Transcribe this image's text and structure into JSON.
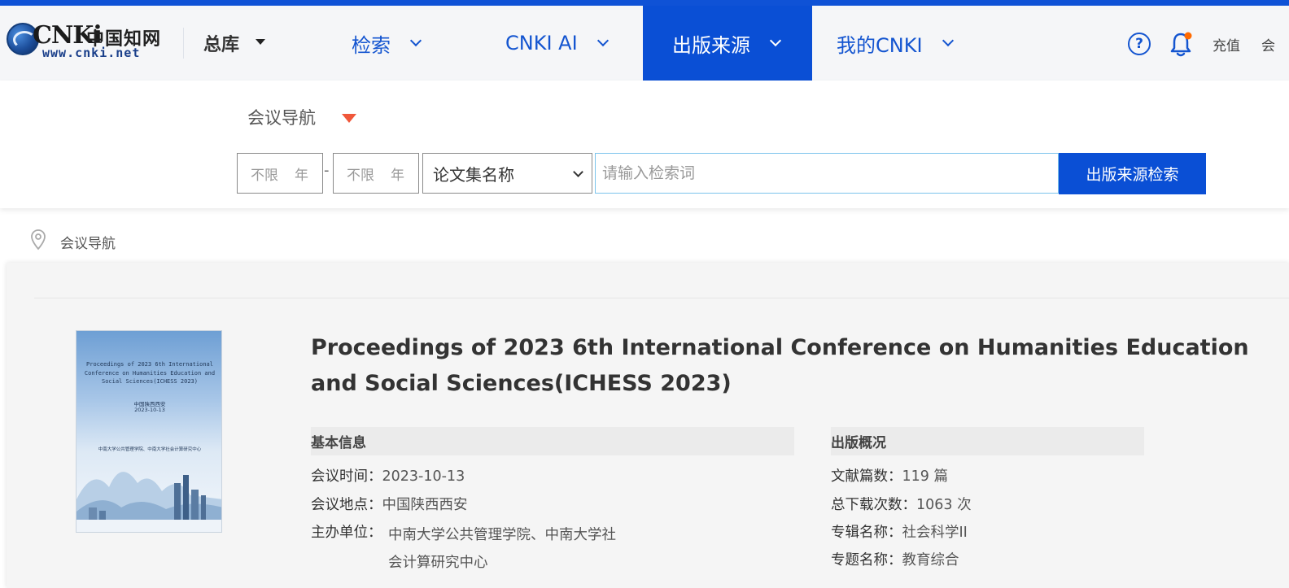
{
  "header": {
    "logo": {
      "brand": "CNKi",
      "brand_cn": "中国知网",
      "url": "www.cnki.net"
    },
    "nav": {
      "zongku": "总库",
      "jiansuo": "检索",
      "cnki_ai": "CNKI AI",
      "source": "出版来源",
      "my_cnki": "我的CNKI"
    },
    "help_glyph": "?",
    "recharge": "充值",
    "member": "会"
  },
  "search": {
    "category_label": "会议导航",
    "year_from": {
      "value": "不限",
      "unit": "年"
    },
    "year_to": {
      "value": "不限",
      "unit": "年"
    },
    "year_separator": "-",
    "field": "论文集名称",
    "placeholder": "请输入检索词",
    "button": "出版来源检索"
  },
  "breadcrumb": {
    "label": "会议导航"
  },
  "cover": {
    "title": "Proceedings of 2023 6th International Conference on Humanities Education and Social Sciences(ICHESS 2023)",
    "place": "中国陕西西安",
    "date": "2023-10-13",
    "org": "中南大学公共管理学院、中南大学社会计算研究中心"
  },
  "publication": {
    "title": "Proceedings of 2023 6th International Conference on Humanities Education and Social Sciences(ICHESS 2023)",
    "basic_info": {
      "heading": "基本信息",
      "time_label": "会议时间：",
      "time": "2023-10-13",
      "place_label": "会议地点：",
      "place": "中国陕西西安",
      "host_label": "主办单位：",
      "host_line1": "中南大学公共管理学院、中南大学社",
      "host_line2": "会计算研究中心"
    },
    "overview": {
      "heading": "出版概况",
      "count_label": "文献篇数：",
      "count": "119 篇",
      "downloads_label": "总下载次数：",
      "downloads": "1063 次",
      "series_label": "专辑名称：",
      "series": "社会科学II",
      "topic_label": "专题名称：",
      "topic": "教育综合"
    }
  },
  "colors": {
    "brand_blue": "#0a4fd5",
    "nav_text": "#1455d0",
    "accent_red": "#f0573a",
    "notify_dot": "#ff6a00"
  }
}
